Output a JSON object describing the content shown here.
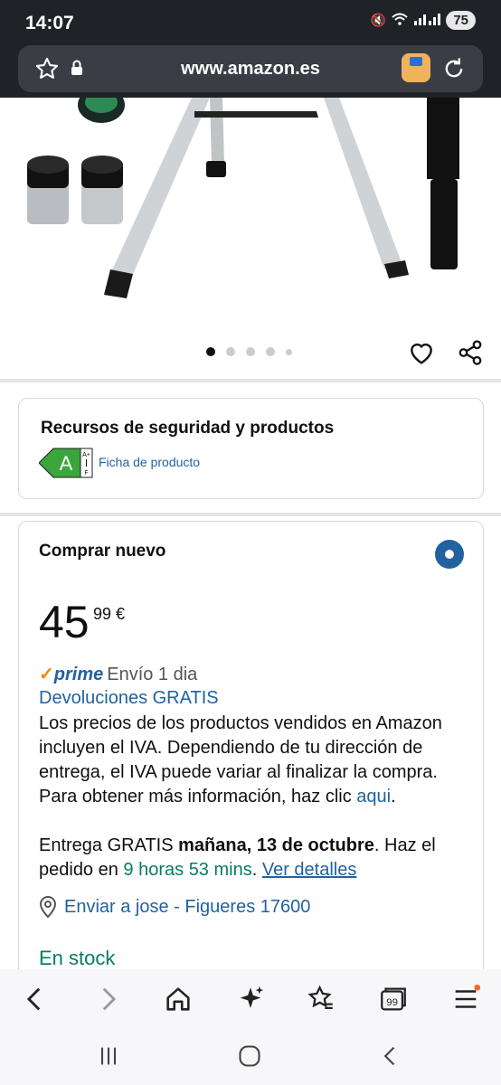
{
  "status_bar": {
    "time": "14:07",
    "battery": "75"
  },
  "url_bar": {
    "url": "www.amazon.es"
  },
  "gallery": {
    "dots_count": 5,
    "active_dot": 0
  },
  "safety": {
    "title": "Recursos de seguridad y productos",
    "energy_class": "A",
    "energy_scale_top": "A+",
    "energy_scale_bottom": "F",
    "link_label": "Ficha de producto"
  },
  "buy": {
    "title": "Comprar nuevo",
    "price_whole": "45",
    "price_fraction": "99 €",
    "prime_check": "✓",
    "prime_label": "prime",
    "prime_shipping": "Envío 1 dia",
    "returns": "Devoluciones GRATIS",
    "vat_text": "Los precios de los productos vendidos en Amazon incluyen el IVA. Dependiendo de tu dirección de entrega, el IVA puede variar al finalizar la compra. Para obtener más información, haz clic ",
    "vat_link": "aqui",
    "vat_end": ".",
    "delivery_prefix": "Entrega GRATIS ",
    "delivery_date": "mañana, 13 de octubre",
    "delivery_mid": ". Haz el pedido en ",
    "delivery_time": "9 horas 53 mins",
    "delivery_sep": ". ",
    "delivery_link": "Ver detalles",
    "ship_to": "Enviar a jose - Figueres 17600",
    "stock": "En stock"
  },
  "colors": {
    "link": "#2162a1",
    "green": "#067d62",
    "prime_orange": "#f08804",
    "energy_green": "#3aa63b"
  }
}
